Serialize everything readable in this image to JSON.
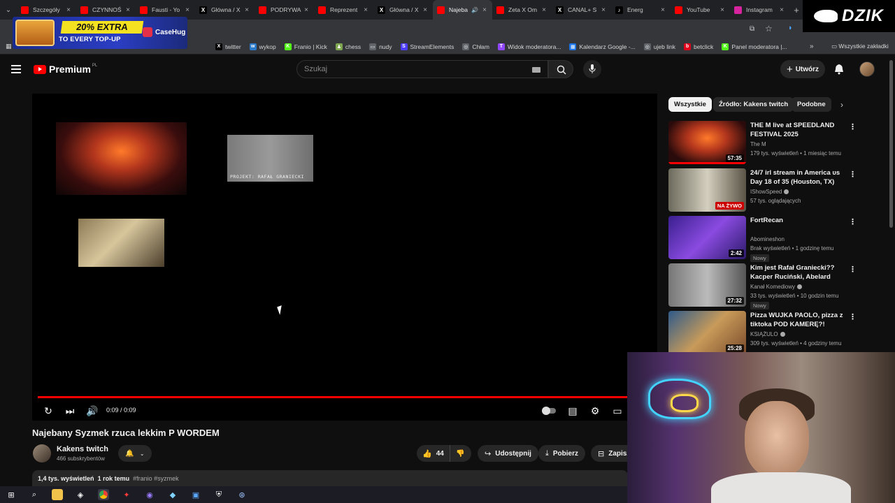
{
  "tabs": [
    {
      "title": "Szczegóły",
      "fav_color": "#ff0000"
    },
    {
      "title": "CZYNNOŚ",
      "fav_color": "#ff0000"
    },
    {
      "title": "Fausti - Yo",
      "fav_color": "#ff0000"
    },
    {
      "title": "Główna / X",
      "fav_color": "#000000",
      "fav_glyph": "X"
    },
    {
      "title": "PODRYWA",
      "fav_color": "#ff0000"
    },
    {
      "title": "Reprezent",
      "fav_color": "#ff0000"
    },
    {
      "title": "Główna / X",
      "fav_color": "#000000",
      "fav_glyph": "X"
    },
    {
      "title": "Najeba",
      "fav_color": "#ff0000",
      "active": true
    },
    {
      "title": "Zeta X Om",
      "fav_color": "#ff0000"
    },
    {
      "title": "CANAL+ S",
      "fav_color": "#000000",
      "fav_glyph": "X"
    },
    {
      "title": "Energ",
      "fav_color": "#000000",
      "fav_glyph": "♪"
    },
    {
      "title": "YouTube",
      "fav_color": "#ff0000"
    },
    {
      "title": "Instagram",
      "fav_color": "#d6249f"
    }
  ],
  "ad": {
    "headline": "20% EXTRA",
    "subline": "TO EVERY TOP-UP",
    "brand": "CaseHug"
  },
  "overlay_logo": "DZIK",
  "bookmarks": [
    {
      "label": "twitter",
      "icon": "X",
      "color": "#000000"
    },
    {
      "label": "wykop",
      "icon": "w",
      "color": "#2a78c8"
    },
    {
      "label": "Franio | Kick",
      "icon": "K",
      "color": "#53fc18"
    },
    {
      "label": "chess",
      "icon": "♟",
      "color": "#7fa650"
    },
    {
      "label": "nudy",
      "icon": "▭",
      "color": "#5f6368"
    },
    {
      "label": "StreamElements",
      "icon": "S",
      "color": "#4b3cff"
    },
    {
      "label": "Chłam",
      "icon": "◎",
      "color": "#5f6368"
    },
    {
      "label": "Widok moderatora...",
      "icon": "T",
      "color": "#9146ff"
    },
    {
      "label": "Kalendarz Google -...",
      "icon": "▦",
      "color": "#1a73e8"
    },
    {
      "label": "ujeb link",
      "icon": "◎",
      "color": "#5f6368"
    },
    {
      "label": "betclick",
      "icon": "b",
      "color": "#e1001a"
    },
    {
      "label": "Panel moderatora |...",
      "icon": "K",
      "color": "#53fc18"
    }
  ],
  "bookmarks_all": "Wszystkie zakładki",
  "youtube": {
    "logo_text": "Premium",
    "logo_region": "PL",
    "search_placeholder": "Szukaj",
    "create_label": "Utwórz"
  },
  "player": {
    "end_card_label": "PROJEKT: RAFAŁ GRANIECKI",
    "time": "0:09 / 0:09",
    "progress": 1.0
  },
  "video": {
    "title": "Najebany Syzmek rzuca lekkim P WORDEM",
    "channel": "Kakens twitch",
    "subscribers": "466 subskrybentów",
    "likes": "44",
    "share_label": "Udostępnij",
    "download_label": "Pobierz",
    "save_label": "Zapisz",
    "views": "1,4 tys. wyświetleń",
    "age": "1 rok temu",
    "hashtags": "#franio #syzmek"
  },
  "chips": [
    "Wszystkie",
    "Źródło: Kakens twitch",
    "Podobne"
  ],
  "recommendations": [
    {
      "title": "THE M live at SPEEDLAND FESTIVAL 2025",
      "channel": "The M",
      "meta": "179 tys. wyświetleń • 1 miesiąc temu",
      "duration": "57:35",
      "verified": false,
      "thumb": "fire"
    },
    {
      "title": "24/7 irl stream in America ᴜs Day 18 of 35 (Houston, TX)",
      "channel": "IShowSpeed",
      "meta": "57 tys. oglądających",
      "live": "NA ŻYWO",
      "verified": true,
      "thumb": "irl"
    },
    {
      "title": "FortRecan",
      "channel": "Abomineshon",
      "meta": "Brak wyświetleń • 1 godzinę temu",
      "duration": "2:42",
      "badge": "Nowy",
      "verified": false,
      "thumb": "purple"
    },
    {
      "title": "Kim jest Rafał Graniecki?? Kacper Ruciński, Abelard Giza,...",
      "channel": "Kanał Komediowy",
      "meta": "33 tys. wyświetleń • 10 godzin temu",
      "duration": "27:32",
      "badge": "Nowy",
      "verified": true,
      "thumb": "gray"
    },
    {
      "title": "Pizza WUJKA PAOLO, pizza z tiktoka POD KAMERĘ?!",
      "channel": "KSIĄŻULO",
      "meta": "309 tys. wyświetleń • 4 godziny temu",
      "duration": "25:28",
      "verified": true,
      "thumb": "pizza"
    }
  ],
  "colors": {
    "yt_red": "#ff0000",
    "bg": "#0f0f0f",
    "chip_bg": "#272727"
  }
}
